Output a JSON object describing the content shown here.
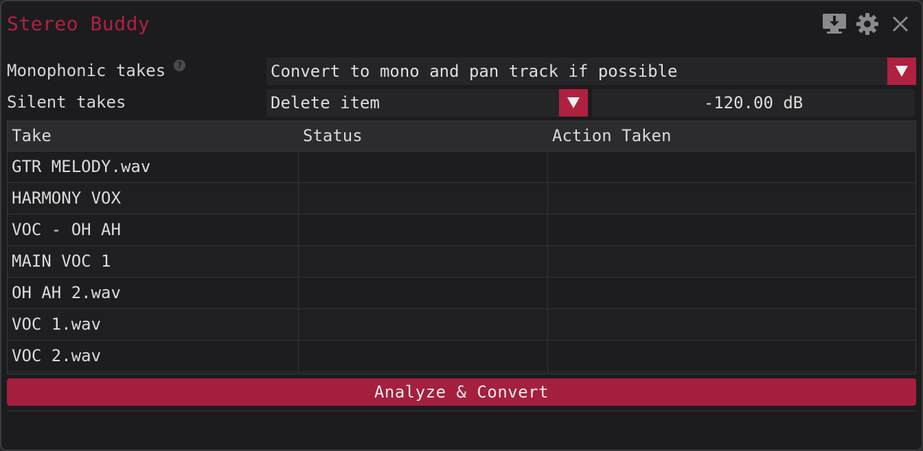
{
  "app": {
    "title": "Stereo Buddy"
  },
  "title_icons": [
    {
      "name": "import-monitor-icon"
    },
    {
      "name": "gear-icon"
    },
    {
      "name": "close-icon"
    }
  ],
  "settings": {
    "mono_label": "Monophonic takes",
    "mono_help_icon": "?",
    "mono_value": "Convert to mono and pan track if possible",
    "silent_label": "Silent takes",
    "silent_value": "Delete item",
    "threshold_value": "-120.00 dB"
  },
  "table": {
    "columns": [
      "Take",
      "Status",
      "Action Taken"
    ],
    "rows": [
      {
        "take": "GTR MELODY.wav",
        "status": "",
        "action": ""
      },
      {
        "take": "HARMONY VOX",
        "status": "",
        "action": ""
      },
      {
        "take": "VOC - OH AH",
        "status": "",
        "action": ""
      },
      {
        "take": "MAIN VOC 1",
        "status": "",
        "action": ""
      },
      {
        "take": "OH AH 2.wav",
        "status": "",
        "action": ""
      },
      {
        "take": "VOC 1.wav",
        "status": "",
        "action": ""
      },
      {
        "take": "VOC 2.wav",
        "status": "",
        "action": ""
      }
    ]
  },
  "actions": {
    "analyze_label": "Analyze & Convert"
  },
  "colors": {
    "accent": "#b0213f",
    "button": "#a51f3e",
    "background": "#1c1c1f"
  }
}
